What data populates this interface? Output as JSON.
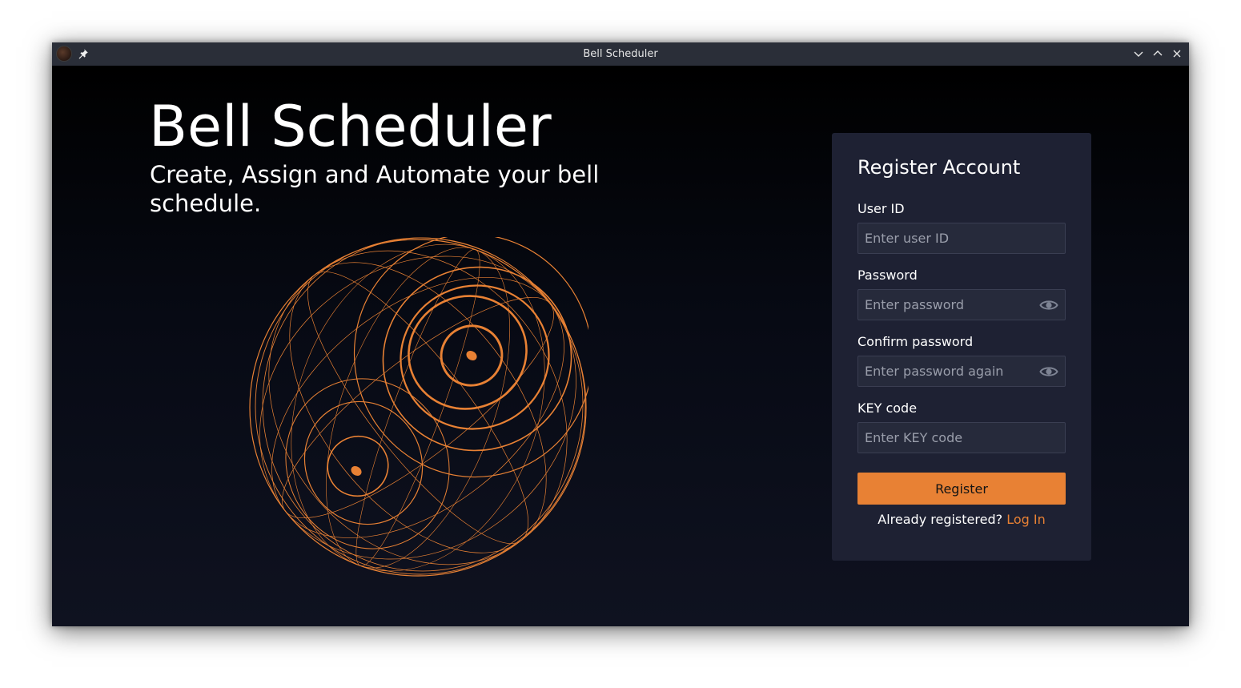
{
  "window": {
    "title": "Bell Scheduler"
  },
  "hero": {
    "title": "Bell Scheduler",
    "subtitle": "Create, Assign and Automate your bell schedule."
  },
  "register": {
    "heading": "Register Account",
    "fields": [
      {
        "label": "User ID",
        "placeholder": "Enter user ID",
        "value": ""
      },
      {
        "label": "Password",
        "placeholder": "Enter password",
        "value": ""
      },
      {
        "label": "Confirm password",
        "placeholder": "Enter password again",
        "value": ""
      },
      {
        "label": "KEY code",
        "placeholder": "Enter KEY code",
        "value": ""
      }
    ],
    "submit_label": "Register",
    "login_prompt": "Already registered?",
    "login_link": "Log In"
  },
  "colors": {
    "accent": "#e88134",
    "card_background": "#1e2133",
    "input_background": "#262a3b",
    "titlebar": "#2a2e38"
  },
  "icons": {
    "app": "app-logo-icon",
    "pin": "pin-icon",
    "minimize": "chevron-down-icon",
    "maximize": "chevron-up-icon",
    "close": "close-icon",
    "show_password": "eye-icon",
    "illustration": "bell-globe-illustration"
  }
}
